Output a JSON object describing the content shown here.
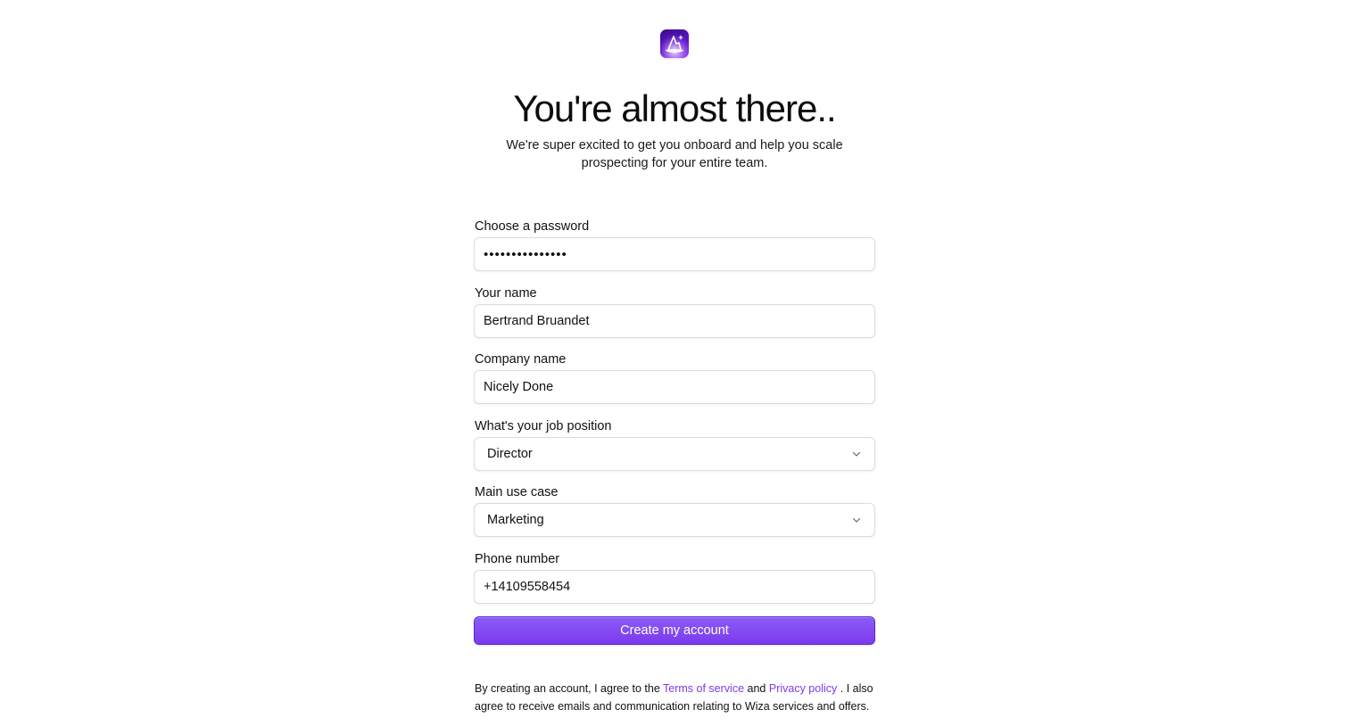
{
  "header": {
    "logo_icon": "wizard-hat-icon",
    "title": "You're almost there..",
    "subtitle": "We're super excited to get you onboard and help you scale prospecting for your entire team."
  },
  "form": {
    "password": {
      "label": "Choose a password",
      "value": "•••••••••••••••"
    },
    "name": {
      "label": "Your name",
      "value": "Bertrand Bruandet"
    },
    "company": {
      "label": "Company name",
      "value": "Nicely Done"
    },
    "job_position": {
      "label": "What's your job position",
      "selected": "Director"
    },
    "use_case": {
      "label": "Main use case",
      "selected": "Marketing"
    },
    "phone": {
      "label": "Phone number",
      "value": "+14109558454"
    },
    "submit_label": "Create my account"
  },
  "legal": {
    "prefix": "By creating an account, I agree to the",
    "terms_link": "Terms of service",
    "and": "and",
    "privacy_link": "Privacy policy",
    "suffix": ". I also agree to receive emails and communication relating to Wiza services and offers."
  },
  "colors": {
    "accent": "#7c3aed",
    "logo_bg": "#5a17c9"
  }
}
